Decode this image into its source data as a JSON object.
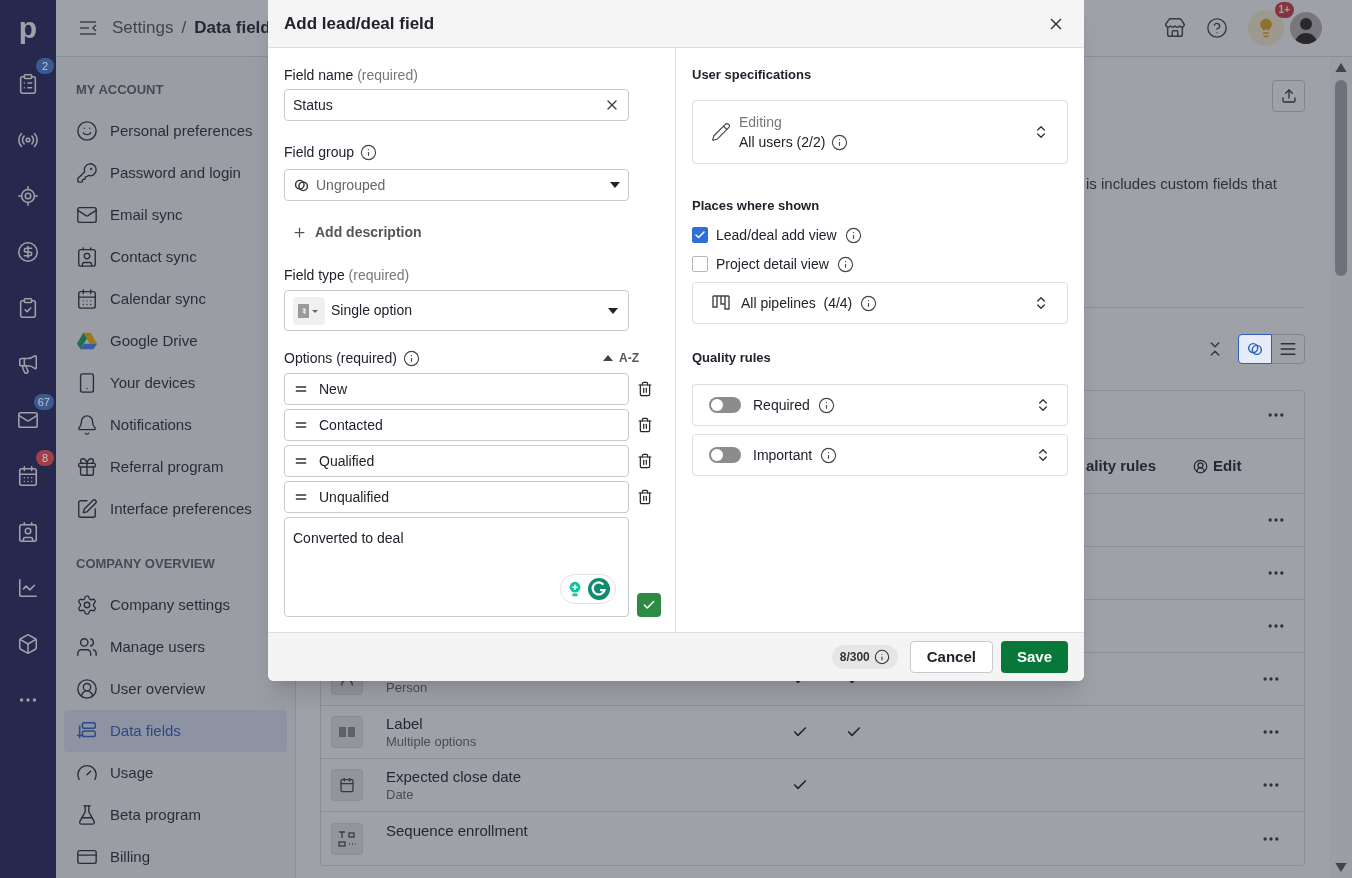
{
  "rail": {
    "logo": "p",
    "badges": [
      {
        "text": "2",
        "color": "#3c5a92"
      },
      {
        "text": "67",
        "color": "#3c5a92"
      },
      {
        "text": "8",
        "color": "#a04046"
      }
    ]
  },
  "topbar": {
    "breadcrumb": [
      "Settings",
      "/",
      "Data field"
    ],
    "notification_badge": "1+"
  },
  "sidebar": {
    "sections": [
      {
        "title": "MY ACCOUNT",
        "items": [
          {
            "label": "Personal preferences",
            "selected": false
          },
          {
            "label": "Password and login",
            "selected": false
          },
          {
            "label": "Email sync",
            "selected": false
          },
          {
            "label": "Contact sync",
            "selected": false
          },
          {
            "label": "Calendar sync",
            "selected": false
          },
          {
            "label": "Google Drive",
            "selected": false
          },
          {
            "label": "Your devices",
            "selected": false
          },
          {
            "label": "Notifications",
            "selected": false
          },
          {
            "label": "Referral program",
            "selected": false
          },
          {
            "label": "Interface preferences",
            "selected": false
          }
        ]
      },
      {
        "title": "COMPANY OVERVIEW",
        "items": [
          {
            "label": "Company settings",
            "selected": false
          },
          {
            "label": "Manage users",
            "selected": false
          },
          {
            "label": "User overview",
            "selected": false
          },
          {
            "label": "Data fields",
            "selected": true
          },
          {
            "label": "Usage",
            "selected": false
          },
          {
            "label": "Beta program",
            "selected": false
          },
          {
            "label": "Billing",
            "selected": false
          }
        ]
      }
    ]
  },
  "content": {
    "description": "is includes custom fields that",
    "view_toggle": [
      {
        "selected": true
      },
      {
        "selected": false
      }
    ],
    "table": {
      "header": {
        "column_quality": "ality rules",
        "column_edit": "Edit"
      },
      "rows": [
        {
          "kind": "covered"
        },
        {
          "kind": "header"
        },
        {
          "kind": "covered"
        },
        {
          "kind": "covered"
        },
        {
          "kind": "covered"
        },
        {
          "kind": "field",
          "type": "Person",
          "column_1": true,
          "column_2": true
        },
        {
          "kind": "field",
          "name": "Label",
          "type": "Multiple options",
          "column_1": true,
          "column_2": true
        },
        {
          "kind": "field",
          "name": "Expected close date",
          "type": "Date",
          "column_1": true,
          "column_2": false
        },
        {
          "kind": "field",
          "name": "Sequence enrollment",
          "column_1": false,
          "column_2": false
        }
      ]
    }
  },
  "modal": {
    "title": "Add lead/deal field",
    "field_name": {
      "label": "Field name",
      "hint": "(required)",
      "value": "Status"
    },
    "field_group": {
      "label": "Field group",
      "value": "Ungrouped"
    },
    "add_description": "Add description",
    "field_type": {
      "label": "Field type",
      "hint": "(required)",
      "value": "Single option"
    },
    "options": {
      "label": "Options (required)",
      "sort": "A-Z",
      "items": [
        "New",
        "Contacted",
        "Qualified",
        "Unqualified"
      ],
      "new_option": "Converted to deal"
    },
    "user_specifications": {
      "title": "User specifications",
      "label": "Editing",
      "value": "All users (2/2)"
    },
    "places": {
      "title": "Places where shown",
      "items": [
        {
          "label": "Lead/deal add view",
          "checked": true
        },
        {
          "label": "Project detail view",
          "checked": false
        }
      ],
      "pipelines": "All pipelines  (4/4)"
    },
    "quality_rules": {
      "title": "Quality rules",
      "items": [
        {
          "label": "Required",
          "on": false
        },
        {
          "label": "Important",
          "on": false
        }
      ]
    },
    "footer": {
      "counter": "8/300",
      "cancel": "Cancel",
      "save": "Save"
    }
  }
}
